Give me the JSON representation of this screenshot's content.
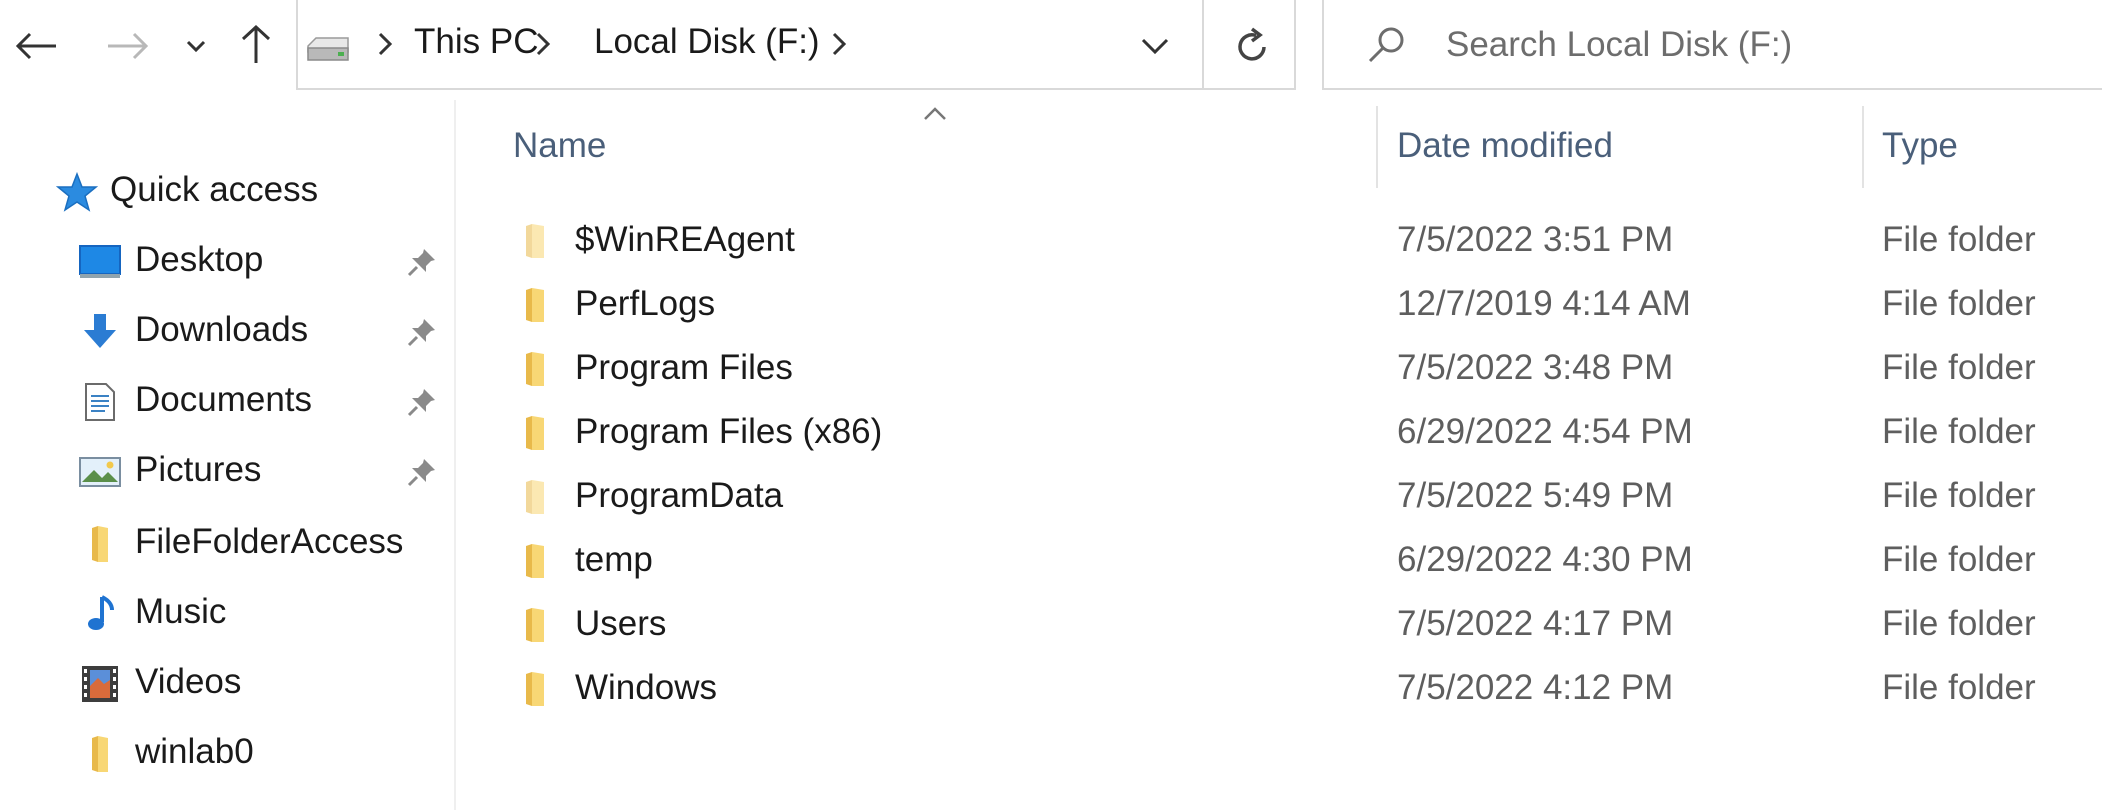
{
  "nav": {
    "back": "back-arrow-icon",
    "forward": "forward-arrow-icon",
    "recent": "chevron-down-icon",
    "up": "up-arrow-icon"
  },
  "address": {
    "breadcrumbs": [
      "This PC",
      "Local Disk (F:)"
    ],
    "refresh": "refresh-icon"
  },
  "search": {
    "placeholder": "Search Local Disk (F:)"
  },
  "sidebar": {
    "quick_access": "Quick access",
    "items": [
      {
        "label": "Desktop",
        "icon": "desktop-icon",
        "pinned": true
      },
      {
        "label": "Downloads",
        "icon": "download-icon",
        "pinned": true
      },
      {
        "label": "Documents",
        "icon": "document-icon",
        "pinned": true
      },
      {
        "label": "Pictures",
        "icon": "pictures-icon",
        "pinned": true
      },
      {
        "label": "FileFolderAccess",
        "icon": "folder-icon",
        "pinned": false
      },
      {
        "label": "Music",
        "icon": "music-icon",
        "pinned": false
      },
      {
        "label": "Videos",
        "icon": "videos-icon",
        "pinned": false
      },
      {
        "label": "winlab0",
        "icon": "folder-icon",
        "pinned": false
      }
    ]
  },
  "columns": {
    "name": "Name",
    "date": "Date modified",
    "type": "Type"
  },
  "files": [
    {
      "name": "$WinREAgent",
      "date": "7/5/2022 3:51 PM",
      "type": "File folder",
      "hidden": true
    },
    {
      "name": "PerfLogs",
      "date": "12/7/2019 4:14 AM",
      "type": "File folder",
      "hidden": false
    },
    {
      "name": "Program Files",
      "date": "7/5/2022 3:48 PM",
      "type": "File folder",
      "hidden": false
    },
    {
      "name": "Program Files (x86)",
      "date": "6/29/2022 4:54 PM",
      "type": "File folder",
      "hidden": false
    },
    {
      "name": "ProgramData",
      "date": "7/5/2022 5:49 PM",
      "type": "File folder",
      "hidden": true
    },
    {
      "name": "temp",
      "date": "6/29/2022 4:30 PM",
      "type": "File folder",
      "hidden": false
    },
    {
      "name": "Users",
      "date": "7/5/2022 4:17 PM",
      "type": "File folder",
      "hidden": false
    },
    {
      "name": "Windows",
      "date": "7/5/2022 4:12 PM",
      "type": "File folder",
      "hidden": false
    }
  ],
  "colors": {
    "folder": "#f8d775",
    "folder_dark": "#e8b94a",
    "accent": "#2b7cd3",
    "header_text": "#4a5f7a"
  }
}
